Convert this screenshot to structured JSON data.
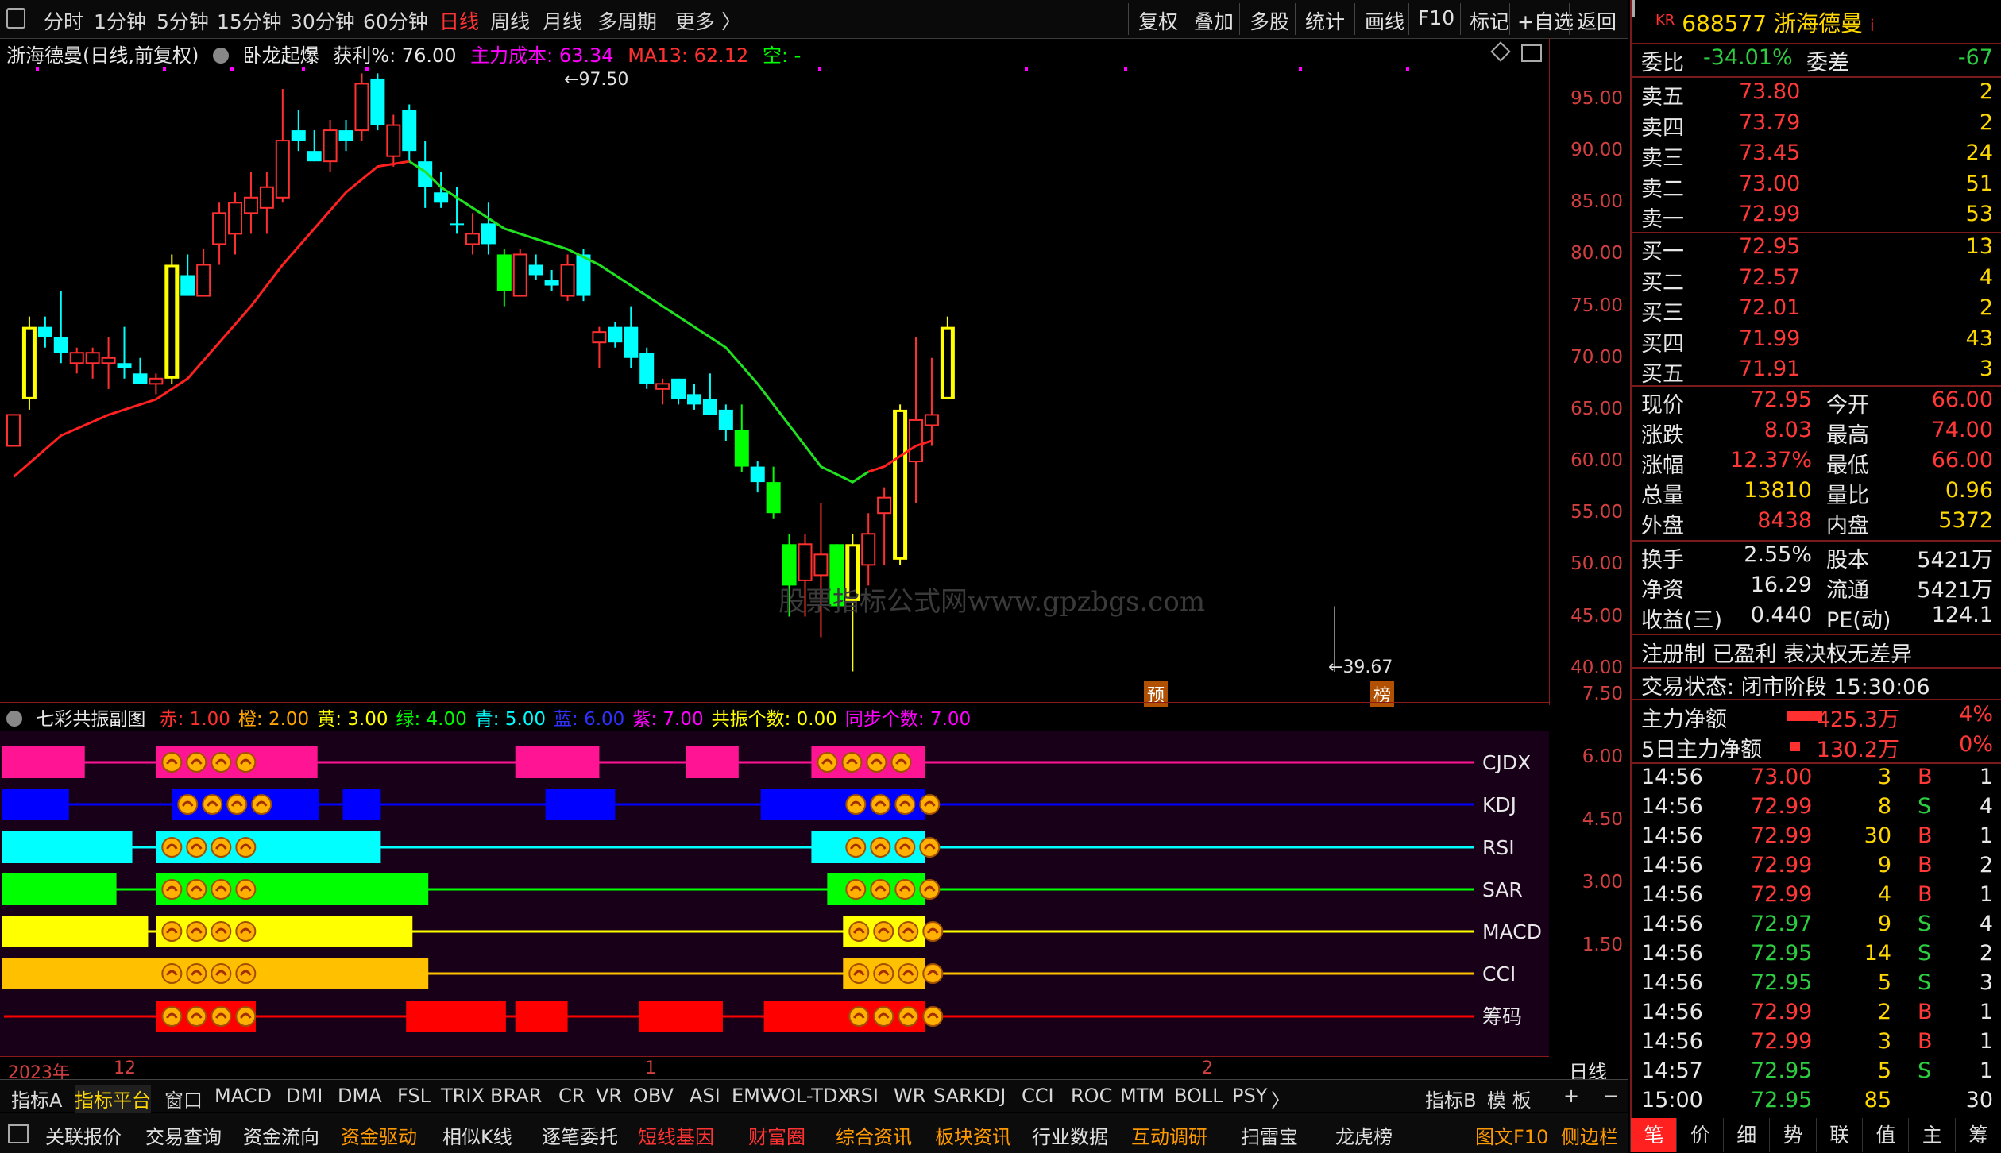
{
  "toolbar": {
    "periods": [
      "分时",
      "1分钟",
      "5分钟",
      "15分钟",
      "30分钟",
      "60分钟",
      "日线",
      "周线",
      "月线",
      "多周期",
      "更多 〉"
    ],
    "active_period": "日线",
    "tools": [
      "复权",
      "叠加",
      "多股",
      "统计",
      "画线",
      "F10",
      "标记",
      "+自选",
      "返回"
    ]
  },
  "main_info": {
    "stock": "浙海德曼(日线,前复权)",
    "indicator": "卧龙起爆",
    "profit": "获利%: 76.00",
    "cost": "主力成本: 63.34",
    "ma": "MA13: 62.12",
    "empty": "空: -"
  },
  "price_axis": [
    "95.00",
    "90.00",
    "85.00",
    "80.00",
    "75.00",
    "70.00",
    "65.00",
    "60.00",
    "55.00",
    "50.00",
    "45.00",
    "40.00"
  ],
  "sub_axis": [
    "7.50",
    "6.00",
    "4.50",
    "3.00",
    "1.50"
  ],
  "watermark": "股票指标公式网www.gpzbgs.com",
  "annotations": {
    "high": "97.50",
    "low": "39.67",
    "mark1": "预",
    "mark2": "榜"
  },
  "sub_info": {
    "name": "七彩共振副图",
    "items": [
      {
        "t": "赤: 1.00",
        "c": "#ff3030"
      },
      {
        "t": "橙: 2.00",
        "c": "#ffa500"
      },
      {
        "t": "黄: 3.00",
        "c": "#ffff00"
      },
      {
        "t": "绿: 4.00",
        "c": "#00ff00"
      },
      {
        "t": "青: 5.00",
        "c": "#00ffff"
      },
      {
        "t": "蓝: 6.00",
        "c": "#3030ff"
      },
      {
        "t": "紫: 7.00",
        "c": "#ff00ff"
      },
      {
        "t": "共振个数: 0.00",
        "c": "#ffff00"
      },
      {
        "t": "同步个数: 7.00",
        "c": "#ff00ff"
      }
    ]
  },
  "sub_rows": [
    "CJDX",
    "KDJ",
    "RSI",
    "SAR",
    "MACD",
    "CCI",
    "筹码"
  ],
  "date_axis": [
    "2023年",
    "12",
    "1",
    "2"
  ],
  "period_label": "日线",
  "bottom_tabs": [
    "指标A",
    "指标平台",
    "窗口",
    "MACD",
    "DMI",
    "DMA",
    "FSL",
    "TRIX",
    "BRAR",
    "CR",
    "VR",
    "OBV",
    "ASI",
    "EMV",
    "VOL-TDX",
    "RSI",
    "WR",
    "SAR",
    "KDJ",
    "CCI",
    "ROC",
    "MTM",
    "BOLL",
    "PSY",
    "〉"
  ],
  "bottom_right": [
    "指标B",
    "模 板",
    "+",
    "−"
  ],
  "bottom_bar": [
    "关联报价",
    "交易查询",
    "资金流向",
    "资金驱动",
    "相似K线",
    "逐笔委托",
    "短线基因",
    "财富圈",
    "综合资讯",
    "板块资讯",
    "行业数据",
    "互动调研",
    "扫雷宝",
    "龙虎榜",
    "图文F10",
    "侧边栏"
  ],
  "quote": {
    "code": "688577",
    "name": "浙海德曼",
    "prefix": "KR",
    "weibi": {
      "label": "委比",
      "value": "-34.01%",
      "label2": "委差",
      "value2": "-67"
    },
    "sells": [
      [
        "卖五",
        "73.80",
        "2"
      ],
      [
        "卖四",
        "73.79",
        "2"
      ],
      [
        "卖三",
        "73.45",
        "24"
      ],
      [
        "卖二",
        "73.00",
        "51"
      ],
      [
        "卖一",
        "72.99",
        "53"
      ]
    ],
    "buys": [
      [
        "买一",
        "72.95",
        "13"
      ],
      [
        "买二",
        "72.57",
        "4"
      ],
      [
        "买三",
        "72.01",
        "2"
      ],
      [
        "买四",
        "71.99",
        "43"
      ],
      [
        "买五",
        "71.91",
        "3"
      ]
    ],
    "stats": [
      [
        "现价",
        "72.95",
        "今开",
        "66.00"
      ],
      [
        "涨跌",
        "8.03",
        "最高",
        "74.00"
      ],
      [
        "涨幅",
        "12.37%",
        "最低",
        "66.00"
      ],
      [
        "总量",
        "13810",
        "量比",
        "0.96"
      ],
      [
        "外盘",
        "8438",
        "内盘",
        "5372"
      ]
    ],
    "stats2": [
      [
        "换手",
        "2.55%",
        "股本",
        "5421万"
      ],
      [
        "净资",
        "16.29",
        "流通",
        "5421万"
      ],
      [
        "收益(三)",
        "0.440",
        "PE(动)",
        "124.1"
      ]
    ],
    "tag": "注册制 已盈利 表决权无差异",
    "status": "交易状态: 闭市阶段 15:30:06",
    "flow": [
      [
        "主力净额",
        "425.3万",
        "4%"
      ],
      [
        "5日主力净额",
        "130.2万",
        "0%"
      ]
    ],
    "ticks": [
      [
        "14:56",
        "73.00",
        "3",
        "B",
        "1"
      ],
      [
        "14:56",
        "72.99",
        "8",
        "S",
        "4"
      ],
      [
        "14:56",
        "72.99",
        "30",
        "B",
        "1"
      ],
      [
        "14:56",
        "72.99",
        "9",
        "B",
        "2"
      ],
      [
        "14:56",
        "72.99",
        "4",
        "B",
        "1"
      ],
      [
        "14:56",
        "72.97",
        "9",
        "S",
        "4"
      ],
      [
        "14:56",
        "72.95",
        "14",
        "S",
        "2"
      ],
      [
        "14:56",
        "72.95",
        "5",
        "S",
        "3"
      ],
      [
        "14:56",
        "72.99",
        "2",
        "B",
        "1"
      ],
      [
        "14:56",
        "72.99",
        "3",
        "B",
        "1"
      ],
      [
        "14:57",
        "72.95",
        "5",
        "S",
        "1"
      ],
      [
        "15:00",
        "72.95",
        "85",
        "",
        "30"
      ]
    ]
  },
  "right_tabs": [
    "笔",
    "价",
    "细",
    "势",
    "联",
    "值",
    "主",
    "筹"
  ],
  "candles": [
    [
      61.5,
      64.5,
      61.5,
      64.5,
      "r"
    ],
    [
      66,
      74,
      65,
      73,
      "y"
    ],
    [
      73,
      74,
      71,
      72,
      "c"
    ],
    [
      72,
      76.5,
      69.5,
      70.5,
      "c"
    ],
    [
      69.5,
      71,
      68.5,
      70.5,
      "r"
    ],
    [
      69.5,
      71,
      68,
      70.5,
      "r"
    ],
    [
      70,
      72,
      67,
      69.5,
      "r"
    ],
    [
      69.5,
      73,
      68,
      69,
      "c"
    ],
    [
      68.5,
      70,
      67.5,
      67.5,
      "c"
    ],
    [
      67.5,
      68.5,
      66.5,
      68,
      "r"
    ],
    [
      68,
      80,
      67.5,
      79,
      "y"
    ],
    [
      78,
      80,
      76,
      76,
      "c"
    ],
    [
      76,
      80.5,
      76,
      79,
      "r"
    ],
    [
      81,
      85,
      79,
      84,
      "r"
    ],
    [
      82,
      86,
      80,
      85,
      "r"
    ],
    [
      84,
      88,
      82,
      85.5,
      "r"
    ],
    [
      84.5,
      88,
      82,
      86.5,
      "r"
    ],
    [
      85.5,
      96,
      85,
      91,
      "r"
    ],
    [
      92,
      94,
      90,
      91,
      "c"
    ],
    [
      90,
      92,
      89,
      89,
      "c"
    ],
    [
      89,
      93,
      88,
      92,
      "r"
    ],
    [
      92,
      93,
      90,
      91,
      "c"
    ],
    [
      92,
      97.5,
      91,
      96.5,
      "r"
    ],
    [
      97,
      97.5,
      92,
      92.5,
      "c"
    ],
    [
      89.5,
      93.5,
      88.5,
      92.5,
      "r"
    ],
    [
      94,
      94.5,
      89,
      90,
      "c"
    ],
    [
      89,
      91,
      84.5,
      86.5,
      "c"
    ],
    [
      86,
      88,
      84.5,
      85,
      "c"
    ],
    [
      83,
      86.5,
      82,
      83,
      "c"
    ],
    [
      82,
      84,
      80,
      81,
      "r"
    ],
    [
      83,
      85,
      80,
      81,
      "c"
    ],
    [
      80,
      80.5,
      75,
      76.5,
      "g"
    ],
    [
      76,
      80.5,
      76,
      80,
      "r"
    ],
    [
      79,
      80,
      77.5,
      78,
      "c"
    ],
    [
      77.5,
      78.5,
      76.5,
      77,
      "c"
    ],
    [
      76,
      80,
      75.5,
      79,
      "r"
    ],
    [
      80,
      80.5,
      75.5,
      76,
      "c"
    ],
    [
      71.5,
      73,
      69,
      72.5,
      "r"
    ],
    [
      73,
      73.5,
      71,
      71.5,
      "c"
    ],
    [
      73,
      75,
      69,
      70,
      "c"
    ],
    [
      70.5,
      71,
      67,
      67.5,
      "c"
    ],
    [
      67,
      68,
      65.5,
      67.5,
      "r"
    ],
    [
      68,
      68,
      65.5,
      66,
      "c"
    ],
    [
      66.5,
      67.5,
      65,
      65.5,
      "c"
    ],
    [
      66,
      68.5,
      64.5,
      64.5,
      "c"
    ],
    [
      65,
      65.5,
      62,
      63,
      "c"
    ],
    [
      63,
      65.5,
      59,
      59.5,
      "g"
    ],
    [
      59.5,
      60,
      57,
      58,
      "c"
    ],
    [
      58,
      59.5,
      54.5,
      55,
      "g"
    ],
    [
      52,
      53,
      45,
      48,
      "g"
    ],
    [
      48.5,
      53,
      45,
      52,
      "r"
    ],
    [
      51,
      56,
      43,
      49,
      "r"
    ],
    [
      52,
      52,
      46,
      46,
      "g"
    ],
    [
      52,
      53,
      39.7,
      46.5,
      "y"
    ],
    [
      50,
      55,
      48,
      53,
      "r"
    ],
    [
      55,
      57.5,
      50,
      56.5,
      "r"
    ],
    [
      50.5,
      65.5,
      50,
      65,
      "y"
    ],
    [
      60,
      72,
      56,
      64,
      "r"
    ],
    [
      63.5,
      70,
      61.5,
      64.5,
      "r"
    ],
    [
      66,
      74,
      66,
      73,
      "y"
    ]
  ],
  "ma13": [
    [
      0,
      58.5
    ],
    [
      3,
      62.5
    ],
    [
      6,
      64.5
    ],
    [
      9,
      66
    ],
    [
      11,
      68
    ],
    [
      13,
      71.5
    ],
    [
      15,
      75
    ],
    [
      17,
      79
    ],
    [
      19,
      82.5
    ],
    [
      21,
      86
    ],
    [
      23,
      88.5
    ],
    [
      25,
      89
    ],
    [
      26,
      88
    ],
    [
      27,
      86.5
    ],
    [
      28,
      85.5
    ],
    [
      29,
      84.5
    ],
    [
      30,
      83.5
    ],
    [
      31,
      82.5
    ],
    [
      33,
      81.5
    ],
    [
      35,
      80.5
    ],
    [
      37,
      79
    ],
    [
      39,
      77
    ],
    [
      41,
      75
    ],
    [
      43,
      73
    ],
    [
      45,
      71
    ],
    [
      47,
      67.5
    ],
    [
      49,
      63.5
    ],
    [
      51,
      59.5
    ],
    [
      53,
      58
    ],
    [
      54,
      59
    ],
    [
      55,
      59.5
    ],
    [
      56,
      60.5
    ],
    [
      57,
      61.5
    ],
    [
      58,
      62
    ]
  ],
  "sub_segments": [
    {
      "row": 0,
      "color": "#ff1493",
      "blocks": [
        [
          0,
          4
        ],
        [
          9.6,
          15.8
        ],
        [
          16.5,
          18.7
        ],
        [
          32.3,
          36.5
        ],
        [
          43.1,
          45.3
        ],
        [
          51,
          57.1
        ]
      ],
      "emoji": [
        9.6,
        51
      ]
    },
    {
      "row": 1,
      "color": "#0000ff",
      "blocks": [
        [
          0,
          3
        ],
        [
          10.6,
          18.8
        ],
        [
          21.4,
          22.7
        ],
        [
          34.2,
          35.5
        ],
        [
          36.2,
          37.5
        ],
        [
          47.8,
          57.1
        ]
      ],
      "emoji": [
        10.6,
        52.8
      ]
    },
    {
      "row": 2,
      "color": "#00ffff",
      "blocks": [
        [
          0,
          7
        ],
        [
          9.6,
          22.7
        ],
        [
          51,
          57.1
        ]
      ],
      "emoji": [
        9.6,
        52.8
      ]
    },
    {
      "row": 3,
      "color": "#00ff00",
      "blocks": [
        [
          0,
          6
        ],
        [
          9.6,
          25.7
        ],
        [
          52,
          57.1
        ]
      ],
      "emoji": [
        9.6,
        52.8
      ]
    },
    {
      "row": 4,
      "color": "#ffff00",
      "blocks": [
        [
          0,
          8
        ],
        [
          9.6,
          24.7
        ],
        [
          53,
          57.1
        ]
      ],
      "emoji": [
        9.6,
        53
      ]
    },
    {
      "row": 5,
      "color": "#ffc000",
      "blocks": [
        [
          0,
          25.7
        ],
        [
          53,
          57.1
        ]
      ],
      "emoji": [
        9.6,
        53
      ]
    },
    {
      "row": 6,
      "color": "#ff0000",
      "blocks": [
        [
          9.6,
          14.8
        ],
        [
          25.4,
          30.6
        ],
        [
          32.3,
          34.5
        ],
        [
          40.1,
          44.3
        ],
        [
          48.0,
          57.1
        ]
      ],
      "emoji": [
        9.6,
        53
      ]
    }
  ]
}
